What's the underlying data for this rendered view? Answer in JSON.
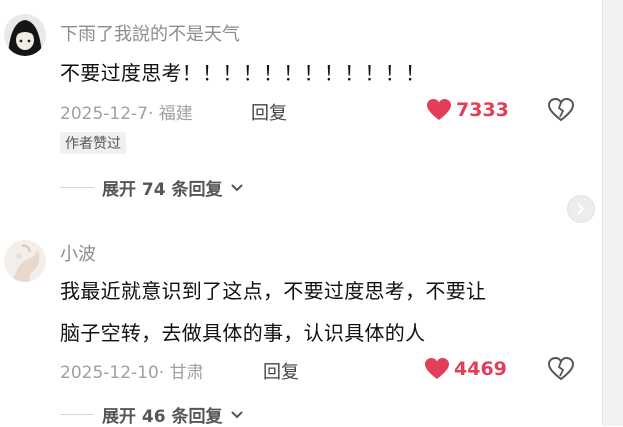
{
  "comments": [
    {
      "username": "下雨了我說的不是天气",
      "content_lines": [
        "不要过度思考！！！！！！！！！！！！"
      ],
      "meta": "2025-12-7· 福建",
      "reply_label": "回复",
      "likes": "7333",
      "badge": "作者赞过",
      "expand_label": "展开 74 条回复"
    },
    {
      "username": "小波",
      "content_lines": [
        "我最近就意识到了这点，不要过度思考，不要让",
        "脑子空转，去做具体的事，认识具体的人"
      ],
      "meta": "2025-12-10· 甘肃",
      "reply_label": "回复",
      "likes": "4469",
      "expand_label": "展开 46 条回复"
    }
  ],
  "colors": {
    "like": "#e23e57",
    "meta": "#a0a0a0",
    "username": "#8d8d8d"
  },
  "icons": {
    "like": "heart-icon",
    "dislike": "broken-heart-icon",
    "expand": "chevron-down-icon",
    "scroll": "chevron-right-icon"
  }
}
